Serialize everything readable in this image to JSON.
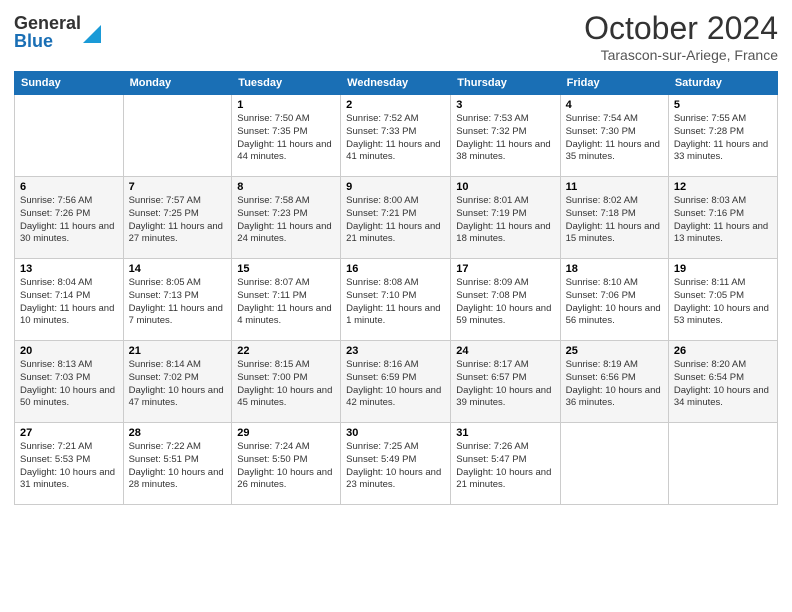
{
  "header": {
    "logo_general": "General",
    "logo_blue": "Blue",
    "month_title": "October 2024",
    "location": "Tarascon-sur-Ariege, France"
  },
  "weekdays": [
    "Sunday",
    "Monday",
    "Tuesday",
    "Wednesday",
    "Thursday",
    "Friday",
    "Saturday"
  ],
  "weeks": [
    [
      {
        "day": "",
        "sunrise": "",
        "sunset": "",
        "daylight": ""
      },
      {
        "day": "",
        "sunrise": "",
        "sunset": "",
        "daylight": ""
      },
      {
        "day": "1",
        "sunrise": "Sunrise: 7:50 AM",
        "sunset": "Sunset: 7:35 PM",
        "daylight": "Daylight: 11 hours and 44 minutes."
      },
      {
        "day": "2",
        "sunrise": "Sunrise: 7:52 AM",
        "sunset": "Sunset: 7:33 PM",
        "daylight": "Daylight: 11 hours and 41 minutes."
      },
      {
        "day": "3",
        "sunrise": "Sunrise: 7:53 AM",
        "sunset": "Sunset: 7:32 PM",
        "daylight": "Daylight: 11 hours and 38 minutes."
      },
      {
        "day": "4",
        "sunrise": "Sunrise: 7:54 AM",
        "sunset": "Sunset: 7:30 PM",
        "daylight": "Daylight: 11 hours and 35 minutes."
      },
      {
        "day": "5",
        "sunrise": "Sunrise: 7:55 AM",
        "sunset": "Sunset: 7:28 PM",
        "daylight": "Daylight: 11 hours and 33 minutes."
      }
    ],
    [
      {
        "day": "6",
        "sunrise": "Sunrise: 7:56 AM",
        "sunset": "Sunset: 7:26 PM",
        "daylight": "Daylight: 11 hours and 30 minutes."
      },
      {
        "day": "7",
        "sunrise": "Sunrise: 7:57 AM",
        "sunset": "Sunset: 7:25 PM",
        "daylight": "Daylight: 11 hours and 27 minutes."
      },
      {
        "day": "8",
        "sunrise": "Sunrise: 7:58 AM",
        "sunset": "Sunset: 7:23 PM",
        "daylight": "Daylight: 11 hours and 24 minutes."
      },
      {
        "day": "9",
        "sunrise": "Sunrise: 8:00 AM",
        "sunset": "Sunset: 7:21 PM",
        "daylight": "Daylight: 11 hours and 21 minutes."
      },
      {
        "day": "10",
        "sunrise": "Sunrise: 8:01 AM",
        "sunset": "Sunset: 7:19 PM",
        "daylight": "Daylight: 11 hours and 18 minutes."
      },
      {
        "day": "11",
        "sunrise": "Sunrise: 8:02 AM",
        "sunset": "Sunset: 7:18 PM",
        "daylight": "Daylight: 11 hours and 15 minutes."
      },
      {
        "day": "12",
        "sunrise": "Sunrise: 8:03 AM",
        "sunset": "Sunset: 7:16 PM",
        "daylight": "Daylight: 11 hours and 13 minutes."
      }
    ],
    [
      {
        "day": "13",
        "sunrise": "Sunrise: 8:04 AM",
        "sunset": "Sunset: 7:14 PM",
        "daylight": "Daylight: 11 hours and 10 minutes."
      },
      {
        "day": "14",
        "sunrise": "Sunrise: 8:05 AM",
        "sunset": "Sunset: 7:13 PM",
        "daylight": "Daylight: 11 hours and 7 minutes."
      },
      {
        "day": "15",
        "sunrise": "Sunrise: 8:07 AM",
        "sunset": "Sunset: 7:11 PM",
        "daylight": "Daylight: 11 hours and 4 minutes."
      },
      {
        "day": "16",
        "sunrise": "Sunrise: 8:08 AM",
        "sunset": "Sunset: 7:10 PM",
        "daylight": "Daylight: 11 hours and 1 minute."
      },
      {
        "day": "17",
        "sunrise": "Sunrise: 8:09 AM",
        "sunset": "Sunset: 7:08 PM",
        "daylight": "Daylight: 10 hours and 59 minutes."
      },
      {
        "day": "18",
        "sunrise": "Sunrise: 8:10 AM",
        "sunset": "Sunset: 7:06 PM",
        "daylight": "Daylight: 10 hours and 56 minutes."
      },
      {
        "day": "19",
        "sunrise": "Sunrise: 8:11 AM",
        "sunset": "Sunset: 7:05 PM",
        "daylight": "Daylight: 10 hours and 53 minutes."
      }
    ],
    [
      {
        "day": "20",
        "sunrise": "Sunrise: 8:13 AM",
        "sunset": "Sunset: 7:03 PM",
        "daylight": "Daylight: 10 hours and 50 minutes."
      },
      {
        "day": "21",
        "sunrise": "Sunrise: 8:14 AM",
        "sunset": "Sunset: 7:02 PM",
        "daylight": "Daylight: 10 hours and 47 minutes."
      },
      {
        "day": "22",
        "sunrise": "Sunrise: 8:15 AM",
        "sunset": "Sunset: 7:00 PM",
        "daylight": "Daylight: 10 hours and 45 minutes."
      },
      {
        "day": "23",
        "sunrise": "Sunrise: 8:16 AM",
        "sunset": "Sunset: 6:59 PM",
        "daylight": "Daylight: 10 hours and 42 minutes."
      },
      {
        "day": "24",
        "sunrise": "Sunrise: 8:17 AM",
        "sunset": "Sunset: 6:57 PM",
        "daylight": "Daylight: 10 hours and 39 minutes."
      },
      {
        "day": "25",
        "sunrise": "Sunrise: 8:19 AM",
        "sunset": "Sunset: 6:56 PM",
        "daylight": "Daylight: 10 hours and 36 minutes."
      },
      {
        "day": "26",
        "sunrise": "Sunrise: 8:20 AM",
        "sunset": "Sunset: 6:54 PM",
        "daylight": "Daylight: 10 hours and 34 minutes."
      }
    ],
    [
      {
        "day": "27",
        "sunrise": "Sunrise: 7:21 AM",
        "sunset": "Sunset: 5:53 PM",
        "daylight": "Daylight: 10 hours and 31 minutes."
      },
      {
        "day": "28",
        "sunrise": "Sunrise: 7:22 AM",
        "sunset": "Sunset: 5:51 PM",
        "daylight": "Daylight: 10 hours and 28 minutes."
      },
      {
        "day": "29",
        "sunrise": "Sunrise: 7:24 AM",
        "sunset": "Sunset: 5:50 PM",
        "daylight": "Daylight: 10 hours and 26 minutes."
      },
      {
        "day": "30",
        "sunrise": "Sunrise: 7:25 AM",
        "sunset": "Sunset: 5:49 PM",
        "daylight": "Daylight: 10 hours and 23 minutes."
      },
      {
        "day": "31",
        "sunrise": "Sunrise: 7:26 AM",
        "sunset": "Sunset: 5:47 PM",
        "daylight": "Daylight: 10 hours and 21 minutes."
      },
      {
        "day": "",
        "sunrise": "",
        "sunset": "",
        "daylight": ""
      },
      {
        "day": "",
        "sunrise": "",
        "sunset": "",
        "daylight": ""
      }
    ]
  ]
}
